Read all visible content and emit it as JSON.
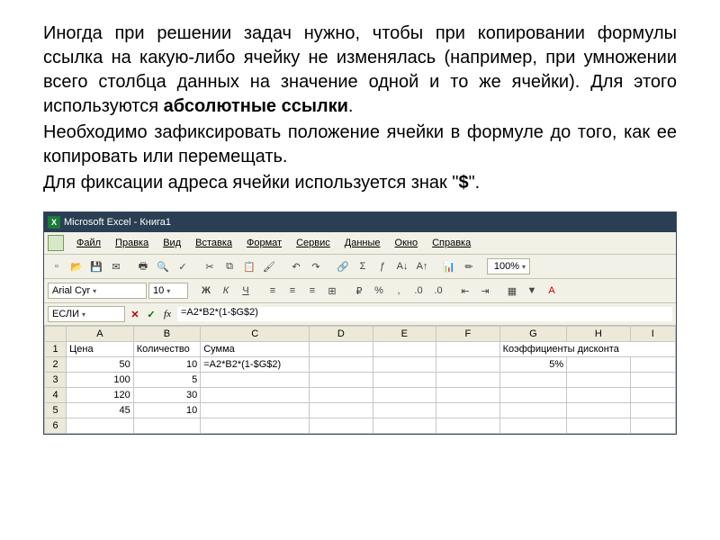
{
  "paragraphs": {
    "p1a": "Иногда при решении задач нужно, чтобы при копировании формулы ссылка на какую-либо ячейку не изменялась (например, при умножении всего столбца данных на значение одной и то же ячейки). Для этого используются ",
    "p1b": "абсолютные ссылки",
    "p1c": ".",
    "p2": "Необходимо зафиксировать положение ячейки в формуле до того, как ее копировать или перемещать.",
    "p3a": "Для фиксации адреса ячейки используется знак \"",
    "p3b": "$",
    "p3c": "\"."
  },
  "title": "Microsoft Excel - Книга1",
  "menu": {
    "file": "Файл",
    "edit": "Правка",
    "view": "Вид",
    "insert": "Вставка",
    "format": "Формат",
    "tools": "Сервис",
    "data": "Данные",
    "window": "Окно",
    "help": "Справка"
  },
  "toolbar1": {
    "zoom": "100%"
  },
  "toolbar2": {
    "font": "Arial Cyr",
    "size": "10",
    "bold": "Ж",
    "italic": "К",
    "underline": "Ч"
  },
  "formulabar": {
    "namebox": "ЕСЛИ",
    "formula": "=A2*B2*(1-$G$2)"
  },
  "columns": [
    "A",
    "B",
    "C",
    "D",
    "E",
    "F",
    "G",
    "H",
    "I"
  ],
  "rows": [
    {
      "n": "1",
      "A": "Цена",
      "B": "Количество",
      "C": "Сумма",
      "G": "Коэффициенты дисконта"
    },
    {
      "n": "2",
      "A": "50",
      "B": "10",
      "C": "=A2*B2*(1-$G$2)",
      "G": "5%"
    },
    {
      "n": "3",
      "A": "100",
      "B": "5"
    },
    {
      "n": "4",
      "A": "120",
      "B": "30"
    },
    {
      "n": "5",
      "A": "45",
      "B": "10"
    },
    {
      "n": "6"
    }
  ]
}
